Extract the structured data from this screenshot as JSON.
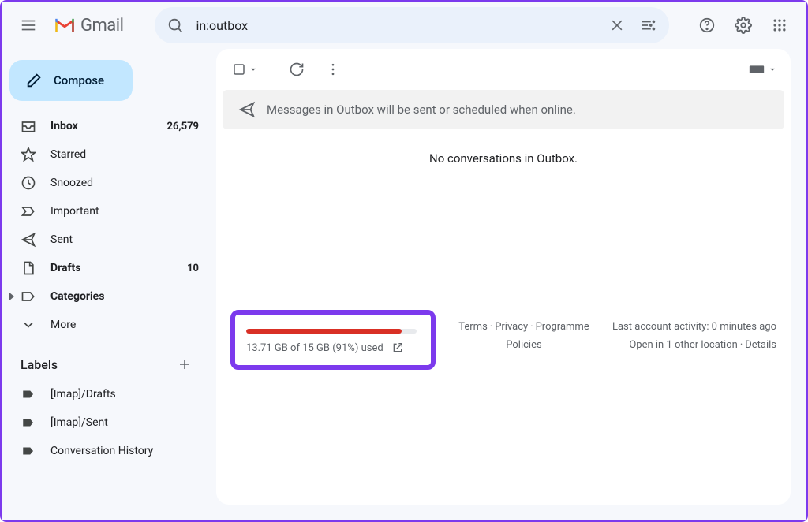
{
  "header": {
    "logo_text": "Gmail",
    "search_value": "in:outbox"
  },
  "compose_label": "Compose",
  "nav": [
    {
      "key": "inbox",
      "label": "Inbox",
      "count": "26,579",
      "bold": true
    },
    {
      "key": "starred",
      "label": "Starred"
    },
    {
      "key": "snoozed",
      "label": "Snoozed"
    },
    {
      "key": "important",
      "label": "Important"
    },
    {
      "key": "sent",
      "label": "Sent"
    },
    {
      "key": "drafts",
      "label": "Drafts",
      "count": "10",
      "bold": true
    },
    {
      "key": "categories",
      "label": "Categories",
      "bold": true
    },
    {
      "key": "more",
      "label": "More"
    }
  ],
  "labels_heading": "Labels",
  "labels": [
    {
      "label": "[Imap]/Drafts"
    },
    {
      "label": "[Imap]/Sent"
    },
    {
      "label": "Conversation History"
    }
  ],
  "banner_text": "Messages in Outbox will be sent or scheduled when online.",
  "empty_text": "No conversations in Outbox.",
  "storage": {
    "percent": 91,
    "text": "13.71 GB of 15 GB (91%) used"
  },
  "footer_links": {
    "terms": "Terms",
    "privacy": "Privacy",
    "programme": "Programme Policies"
  },
  "activity": {
    "line1": "Last account activity: 0 minutes ago",
    "line2_a": "Open in 1 other location",
    "line2_b": "Details"
  }
}
